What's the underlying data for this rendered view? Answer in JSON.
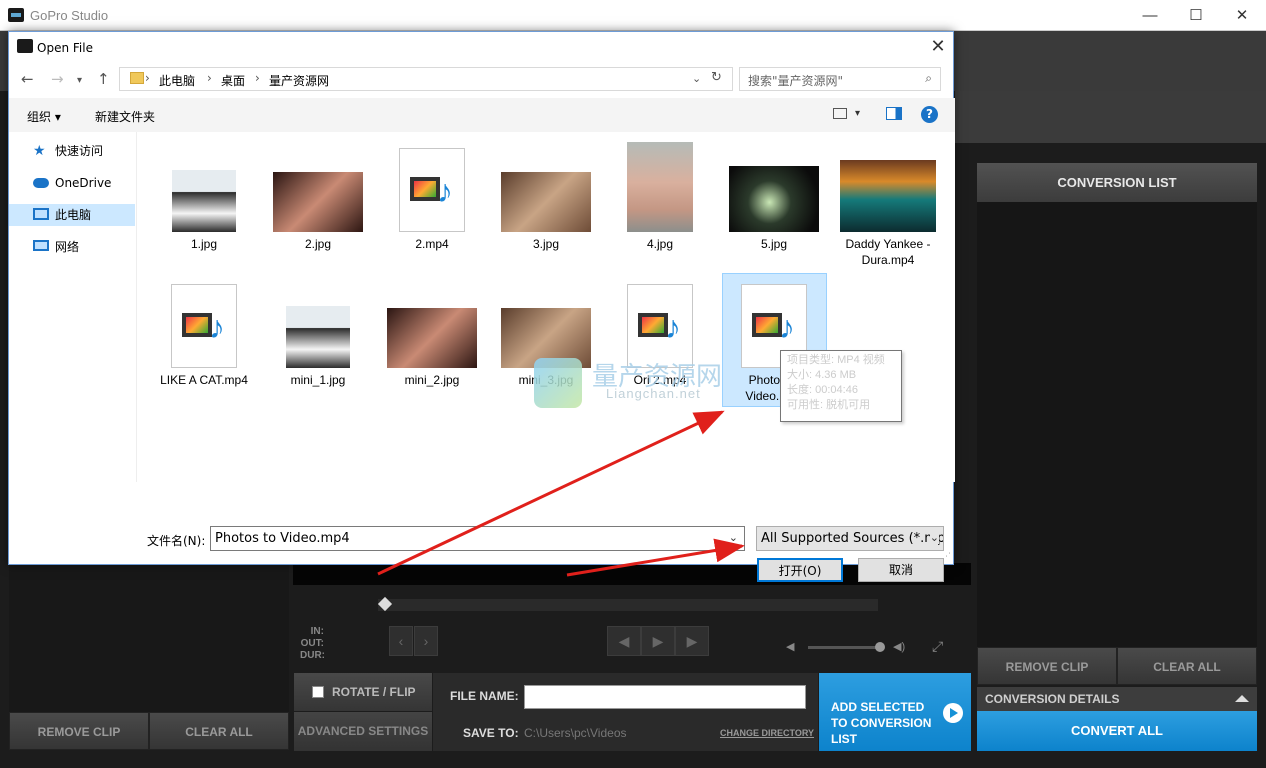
{
  "app": {
    "title": "GoPro Studio",
    "window_controls": {
      "minimize": "—",
      "maximize": "☐",
      "close": "✕"
    }
  },
  "right_panel": {
    "header": "CONVERSION LIST",
    "remove_clip": "REMOVE CLIP",
    "clear_all": "CLEAR ALL",
    "conversion_details": "CONVERSION DETAILS",
    "convert_all": "CONVERT ALL"
  },
  "left_panel": {
    "remove_clip": "REMOVE CLIP",
    "clear_all": "CLEAR ALL"
  },
  "player": {
    "in_label": "IN:",
    "out_label": "OUT:",
    "dur_label": "DUR:"
  },
  "export": {
    "rotate_flip": "ROTATE / FLIP",
    "advanced_settings": "ADVANCED SETTINGS",
    "file_name_label": "FILE NAME:",
    "save_to_label": "SAVE TO:",
    "save_to_path": "C:\\Users\\pc\\Videos",
    "change_directory": "CHANGE DIRECTORY",
    "add_selected": "ADD SELECTED TO CONVERSION LIST",
    "file_name_value": ""
  },
  "dialog": {
    "title": "Open File",
    "breadcrumbs": [
      "此电脑",
      "桌面",
      "量产资源网"
    ],
    "search_placeholder": "搜索\"量产资源网\"",
    "organize": "组织 ▾",
    "new_folder": "新建文件夹",
    "nav": [
      {
        "label": "快速访问"
      },
      {
        "label": "OneDrive"
      },
      {
        "label": "此电脑"
      },
      {
        "label": "网络"
      }
    ],
    "files": [
      {
        "name": "1.jpg",
        "kind": "man"
      },
      {
        "name": "2.jpg",
        "kind": "dark"
      },
      {
        "name": "2.mp4",
        "kind": "video"
      },
      {
        "name": "3.jpg",
        "kind": "hair"
      },
      {
        "name": "4.jpg",
        "kind": "face"
      },
      {
        "name": "5.jpg",
        "kind": "stage"
      },
      {
        "name": "Daddy Yankee - Dura.mp4",
        "kind": "car"
      },
      {
        "name": "LIKE A CAT.mp4",
        "kind": "video"
      },
      {
        "name": "mini_1.jpg",
        "kind": "man"
      },
      {
        "name": "mini_2.jpg",
        "kind": "dark"
      },
      {
        "name": "mini_3.jpg",
        "kind": "hair"
      },
      {
        "name": "Ori 2.mp4",
        "kind": "video"
      },
      {
        "name": "Photos to Video.mp4",
        "kind": "video"
      }
    ],
    "tooltip": {
      "type": "项目类型: MP4 视频",
      "size": "大小: 4.36 MB",
      "length": "长度: 00:04:46",
      "availability": "可用性: 脱机可用"
    },
    "filename_label": "文件名(N):",
    "filename_value": "Photos to Video.mp4",
    "filetype": "All Supported Sources (*.mp",
    "open": "打开(O)",
    "cancel": "取消"
  },
  "watermark": {
    "cn": "量产资源网",
    "en": "Liangchan.net"
  },
  "colors": {
    "accent_blue": "#1591d6",
    "selection": "#cce8ff",
    "arrow_red": "#e0201b"
  }
}
